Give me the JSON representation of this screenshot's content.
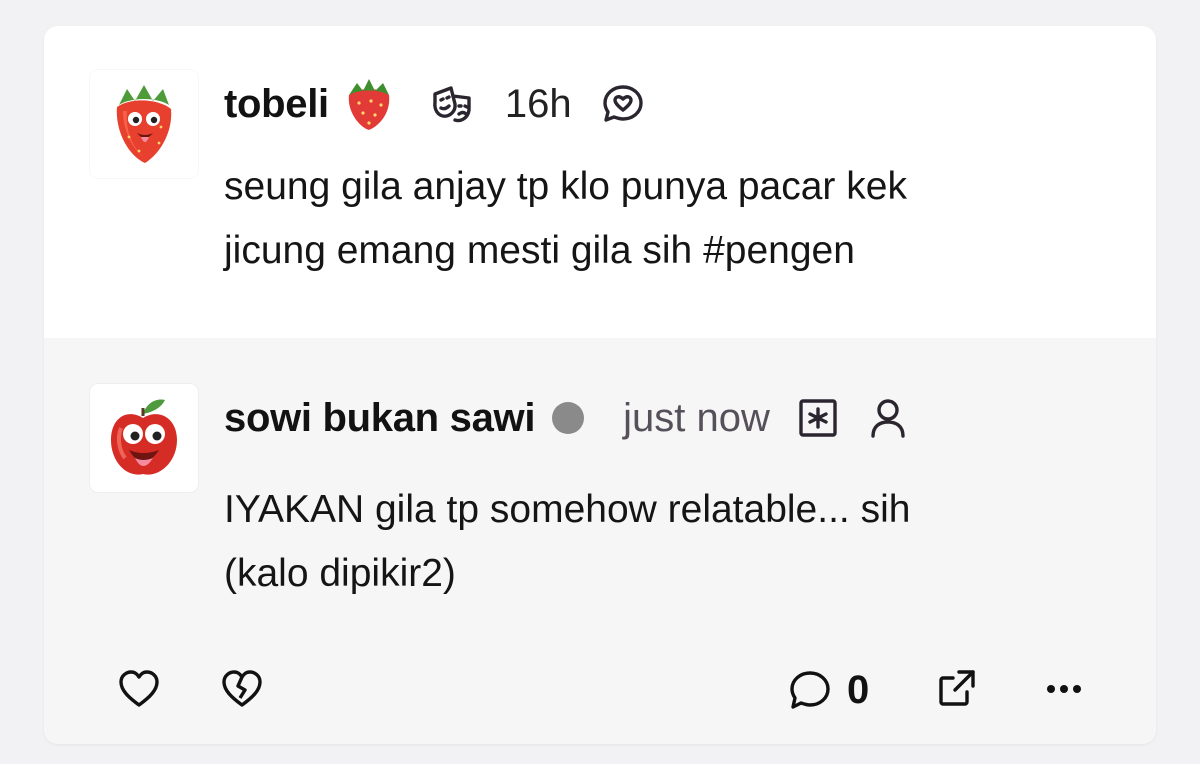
{
  "post": {
    "author": "tobeli",
    "time": "16h",
    "text_line1": "seung gila anjay tp klo punya pacar kek",
    "text_line2": "jicung emang mesti gila sih #pengen"
  },
  "reply": {
    "author": "sowi bukan sawi",
    "time": "just now",
    "text_line1": "IYAKAN gila tp somehow relatable... sih",
    "text_line2": "(kalo dipikir2)"
  },
  "actions": {
    "comment_count": "0"
  },
  "icons": {
    "post_avatar": "strawberry-avatar-icon",
    "post_badge": "strawberry-icon",
    "post_mood": "theater-masks-icon",
    "post_reply": "heart-chat-bubble-icon",
    "reply_avatar": "apple-avatar-icon",
    "reply_status": "status-dot-icon",
    "reply_anon": "asterisk-box-icon",
    "reply_profile": "person-icon",
    "like": "heart-icon",
    "dislike": "broken-heart-icon",
    "comment": "comment-icon",
    "share": "share-icon",
    "more": "more-icon"
  },
  "colors": {
    "background": "#f2f2f4",
    "card": "#ffffff",
    "reply_background": "#f7f6f7",
    "status_dot": "#8a8a8a",
    "icon": "#2b2530"
  }
}
